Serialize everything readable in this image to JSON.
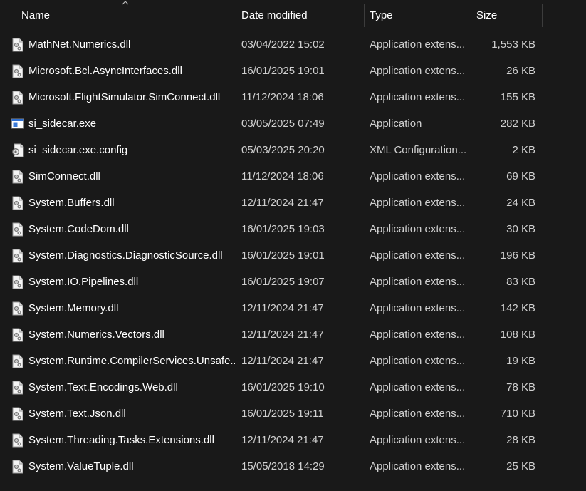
{
  "columns": {
    "name": "Name",
    "date_modified": "Date modified",
    "type": "Type",
    "size": "Size"
  },
  "files": [
    {
      "name": "MathNet.Numerics.dll",
      "date": "03/04/2022 15:02",
      "type": "Application extens...",
      "size": "1,553 KB",
      "icon": "dll-icon"
    },
    {
      "name": "Microsoft.Bcl.AsyncInterfaces.dll",
      "date": "16/01/2025 19:01",
      "type": "Application extens...",
      "size": "26 KB",
      "icon": "dll-icon"
    },
    {
      "name": "Microsoft.FlightSimulator.SimConnect.dll",
      "date": "11/12/2024 18:06",
      "type": "Application extens...",
      "size": "155 KB",
      "icon": "dll-icon"
    },
    {
      "name": "si_sidecar.exe",
      "date": "03/05/2025 07:49",
      "type": "Application",
      "size": "282 KB",
      "icon": "exe-icon"
    },
    {
      "name": "si_sidecar.exe.config",
      "date": "05/03/2025 20:20",
      "type": "XML Configuration...",
      "size": "2 KB",
      "icon": "config-icon"
    },
    {
      "name": "SimConnect.dll",
      "date": "11/12/2024 18:06",
      "type": "Application extens...",
      "size": "69 KB",
      "icon": "dll-icon"
    },
    {
      "name": "System.Buffers.dll",
      "date": "12/11/2024 21:47",
      "type": "Application extens...",
      "size": "24 KB",
      "icon": "dll-icon"
    },
    {
      "name": "System.CodeDom.dll",
      "date": "16/01/2025 19:03",
      "type": "Application extens...",
      "size": "30 KB",
      "icon": "dll-icon"
    },
    {
      "name": "System.Diagnostics.DiagnosticSource.dll",
      "date": "16/01/2025 19:01",
      "type": "Application extens...",
      "size": "196 KB",
      "icon": "dll-icon"
    },
    {
      "name": "System.IO.Pipelines.dll",
      "date": "16/01/2025 19:07",
      "type": "Application extens...",
      "size": "83 KB",
      "icon": "dll-icon"
    },
    {
      "name": "System.Memory.dll",
      "date": "12/11/2024 21:47",
      "type": "Application extens...",
      "size": "142 KB",
      "icon": "dll-icon"
    },
    {
      "name": "System.Numerics.Vectors.dll",
      "date": "12/11/2024 21:47",
      "type": "Application extens...",
      "size": "108 KB",
      "icon": "dll-icon"
    },
    {
      "name": "System.Runtime.CompilerServices.Unsafe....",
      "date": "12/11/2024 21:47",
      "type": "Application extens...",
      "size": "19 KB",
      "icon": "dll-icon"
    },
    {
      "name": "System.Text.Encodings.Web.dll",
      "date": "16/01/2025 19:10",
      "type": "Application extens...",
      "size": "78 KB",
      "icon": "dll-icon"
    },
    {
      "name": "System.Text.Json.dll",
      "date": "16/01/2025 19:11",
      "type": "Application extens...",
      "size": "710 KB",
      "icon": "dll-icon"
    },
    {
      "name": "System.Threading.Tasks.Extensions.dll",
      "date": "12/11/2024 21:47",
      "type": "Application extens...",
      "size": "28 KB",
      "icon": "dll-icon"
    },
    {
      "name": "System.ValueTuple.dll",
      "date": "15/05/2018 14:29",
      "type": "Application extens...",
      "size": "25 KB",
      "icon": "dll-icon"
    }
  ],
  "colors": {
    "background": "#191919",
    "separator": "#3c3c3c",
    "text_primary": "#ffffff",
    "text_secondary": "#d0d0d0"
  },
  "sort": {
    "column": "name",
    "direction": "ascending"
  }
}
